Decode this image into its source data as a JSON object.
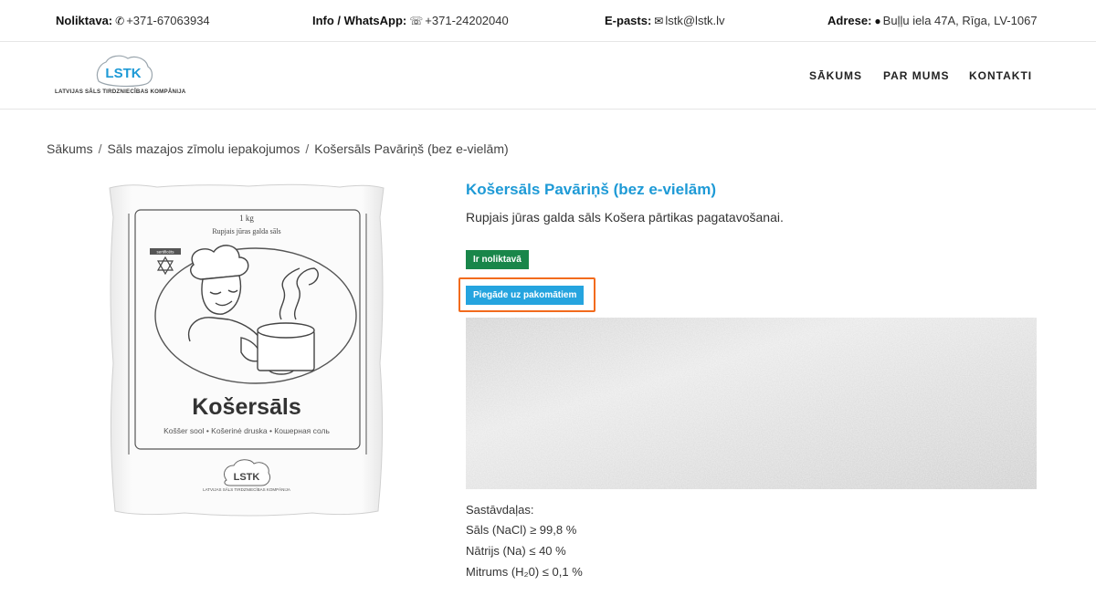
{
  "topbar": {
    "stock": {
      "label": "Noliktava:",
      "value": "+371-67063934",
      "icon": "phone-icon"
    },
    "info": {
      "label": "Info / WhatsApp:",
      "value": "+371-24202040",
      "icon": "whatsapp-icon"
    },
    "email": {
      "label": "E-pasts:",
      "value": "lstk@lstk.lv",
      "icon": "envelope-icon"
    },
    "address": {
      "label": "Adrese:",
      "value": "Buļļu iela 47A, Rīga, LV-1067",
      "icon": "map-pin-icon"
    }
  },
  "header": {
    "logo_text": "LSTK",
    "logo_subtitle": "LATVIJAS SĀLS TIRDZNIECĪBAS KOMPĀNIJA",
    "nav": [
      "SĀKUMS",
      "PAR MUMS",
      "KONTAKTI"
    ]
  },
  "breadcrumb": [
    "Sākums",
    "Sāls mazajos zīmolu iepakojumos",
    "Košersāls Pavāriņš (bez e-vielām)"
  ],
  "product": {
    "title": "Košersāls Pavāriņš (bez e-vielām)",
    "description": "Rupjais jūras galda sāls Košera pārtikas pagatavošanai.",
    "stock_badge": "Ir noliktavā",
    "delivery_badge": "Piegāde uz pakomātiem",
    "package": {
      "weight": "1 kg",
      "subtitle": "Rupjais jūras galda sāls",
      "certified": "sertificēts",
      "name": "Košersāls",
      "translations": "Koššer sool • Košerinė druska • Кошерная соль",
      "brand": "LSTK",
      "brand_subtitle": "LATVIJAS SĀLS TIRDZNIECĪBAS KOMPĀNIJA"
    },
    "composition": {
      "heading": "Sastāvdaļas:",
      "items": [
        "Sāls (NaCl) ≥ 99,8 %",
        "Nātrijs (Na) ≤ 40 %",
        "Mitrums (H₂0) ≤ 0,1 %"
      ]
    }
  },
  "colors": {
    "accent": "#1e9ad6",
    "stock_green": "#19864a",
    "delivery_blue": "#25a4df",
    "highlight": "#f26b1d"
  }
}
